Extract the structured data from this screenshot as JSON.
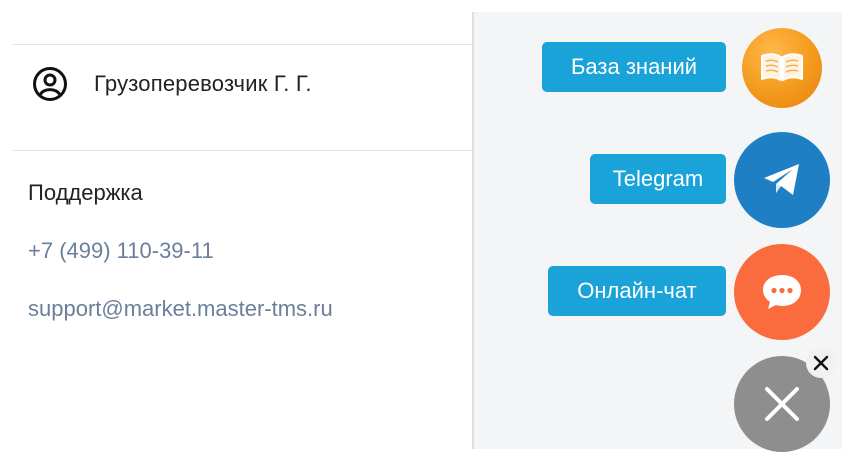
{
  "user": {
    "name": "Грузоперевозчик Г. Г.",
    "icon": "user-circle-icon"
  },
  "support": {
    "title": "Поддержка",
    "phone": "+7 (499) 110-39-11",
    "email": "support@market.master-tms.ru"
  },
  "widget": {
    "buttons": [
      {
        "label": "База знаний",
        "icon": "book-icon",
        "color": "#f39a1c"
      },
      {
        "label": "Telegram",
        "icon": "telegram-plane-icon",
        "color": "#1f7fc4"
      },
      {
        "label": "Онлайн-чат",
        "icon": "chat-bubble-icon",
        "color": "#fa6c3e"
      }
    ],
    "pill_color": "#1aa3d8",
    "close_button": {
      "icon": "close-icon",
      "color": "#8e8e8e"
    },
    "dismiss_button": {
      "icon": "small-close-icon"
    }
  }
}
